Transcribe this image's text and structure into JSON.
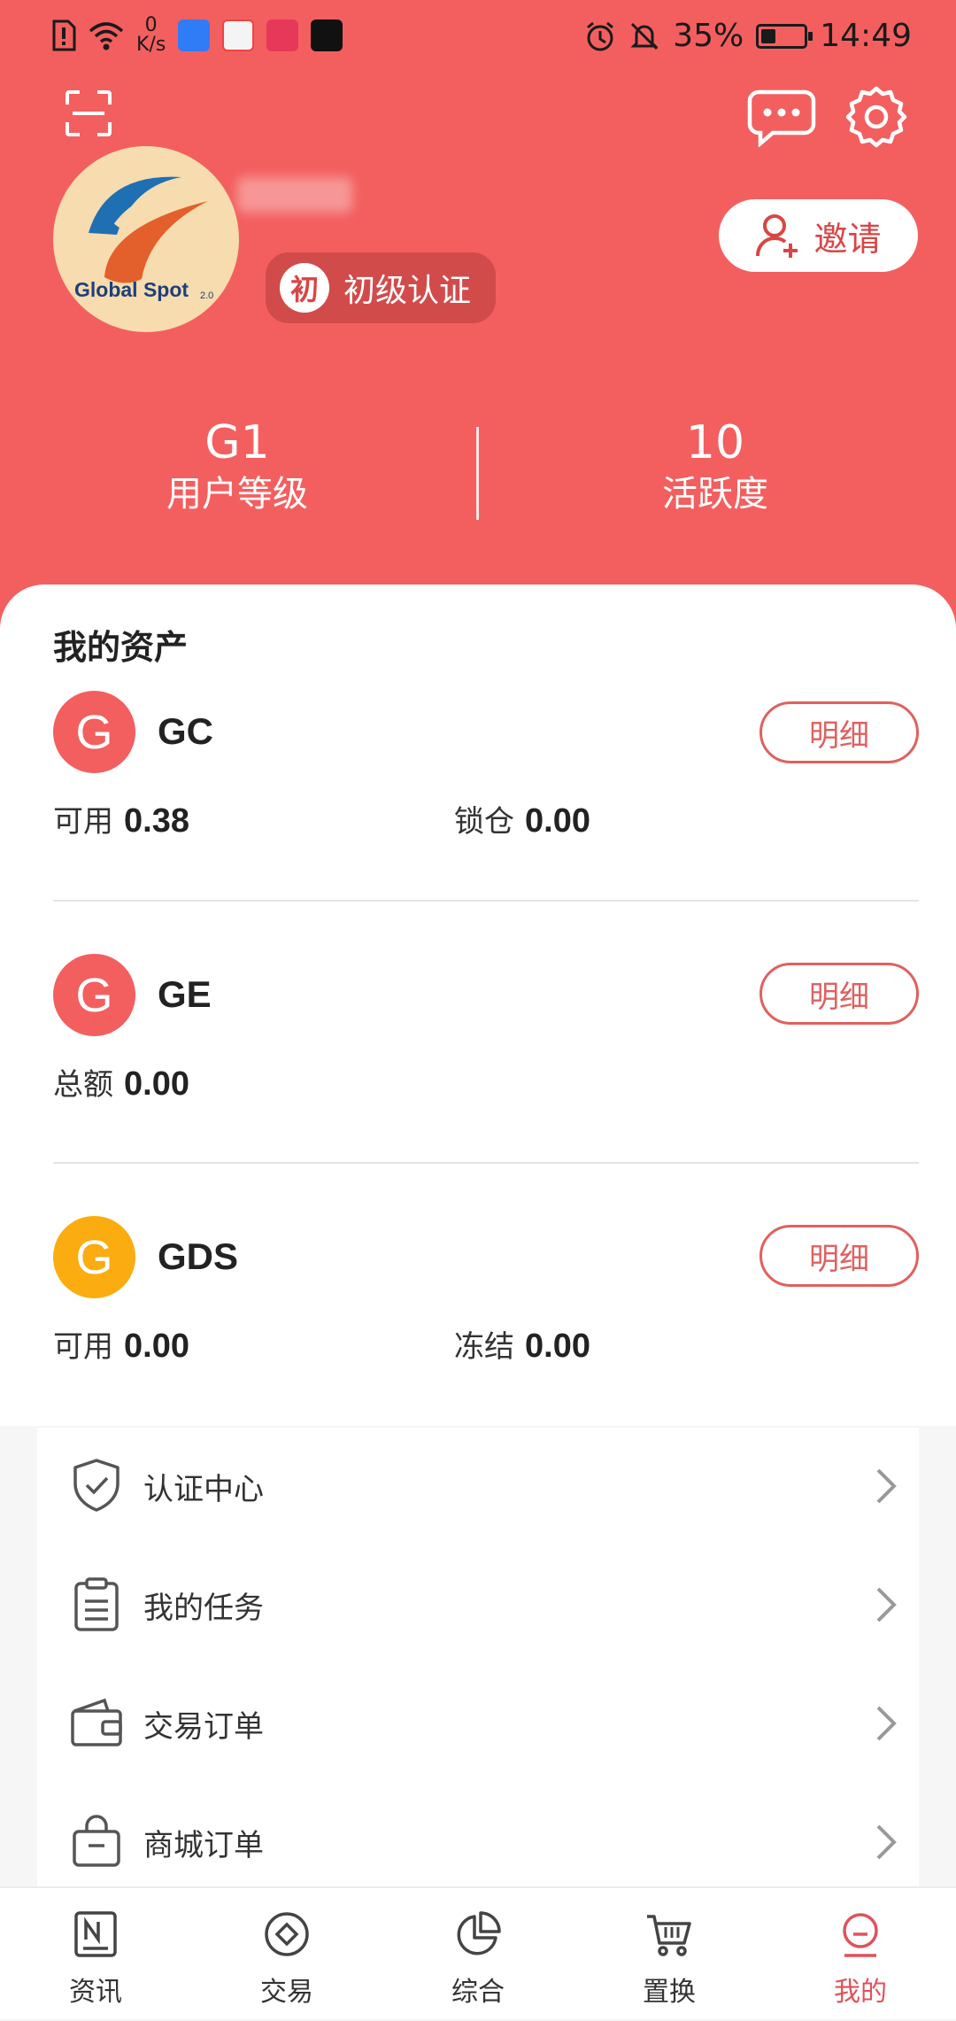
{
  "status_bar": {
    "net_speed_value": "0",
    "net_speed_unit": "K/s",
    "battery_percent": "35%",
    "battery_level": 0.35,
    "time": "14:49"
  },
  "header": {
    "avatar_logo_text": "Global Spot",
    "avatar_logo_version": "2.0",
    "cert_badge_char": "初",
    "cert_badge_label": "初级认证",
    "invite_label": "邀请",
    "stats": [
      {
        "value": "G1",
        "label": "用户等级"
      },
      {
        "value": "10",
        "label": "活跃度"
      }
    ]
  },
  "assets": {
    "title": "我的资产",
    "detail_label": "明细",
    "items": [
      {
        "icon_letter": "G",
        "name": "GC",
        "color": "#f35f5f",
        "balances": [
          {
            "label": "可用",
            "value": "0.38"
          },
          {
            "label": "锁仓",
            "value": "0.00"
          }
        ]
      },
      {
        "icon_letter": "G",
        "name": "GE",
        "color": "#f35f5f",
        "balances": [
          {
            "label": "总额",
            "value": "0.00"
          }
        ]
      },
      {
        "icon_letter": "G",
        "name": "GDS",
        "color": "#fbac10",
        "balances": [
          {
            "label": "可用",
            "value": "0.00"
          },
          {
            "label": "冻结",
            "value": "0.00"
          }
        ]
      }
    ]
  },
  "menu": {
    "items": [
      {
        "label": "认证中心",
        "icon": "shield-check-icon"
      },
      {
        "label": "我的任务",
        "icon": "clipboard-icon"
      },
      {
        "label": "交易订单",
        "icon": "wallet-icon"
      },
      {
        "label": "商城订单",
        "icon": "shopping-bag-icon"
      }
    ]
  },
  "tabs": [
    {
      "label": "资讯",
      "icon": "news-icon"
    },
    {
      "label": "交易",
      "icon": "trade-icon"
    },
    {
      "label": "综合",
      "icon": "pie-chart-icon"
    },
    {
      "label": "置换",
      "icon": "cart-icon"
    },
    {
      "label": "我的",
      "icon": "profile-icon",
      "active": true
    }
  ],
  "colors": {
    "header_bg": "#f35f5f",
    "accent": "#e0525a",
    "gds_coin": "#fbac10"
  }
}
